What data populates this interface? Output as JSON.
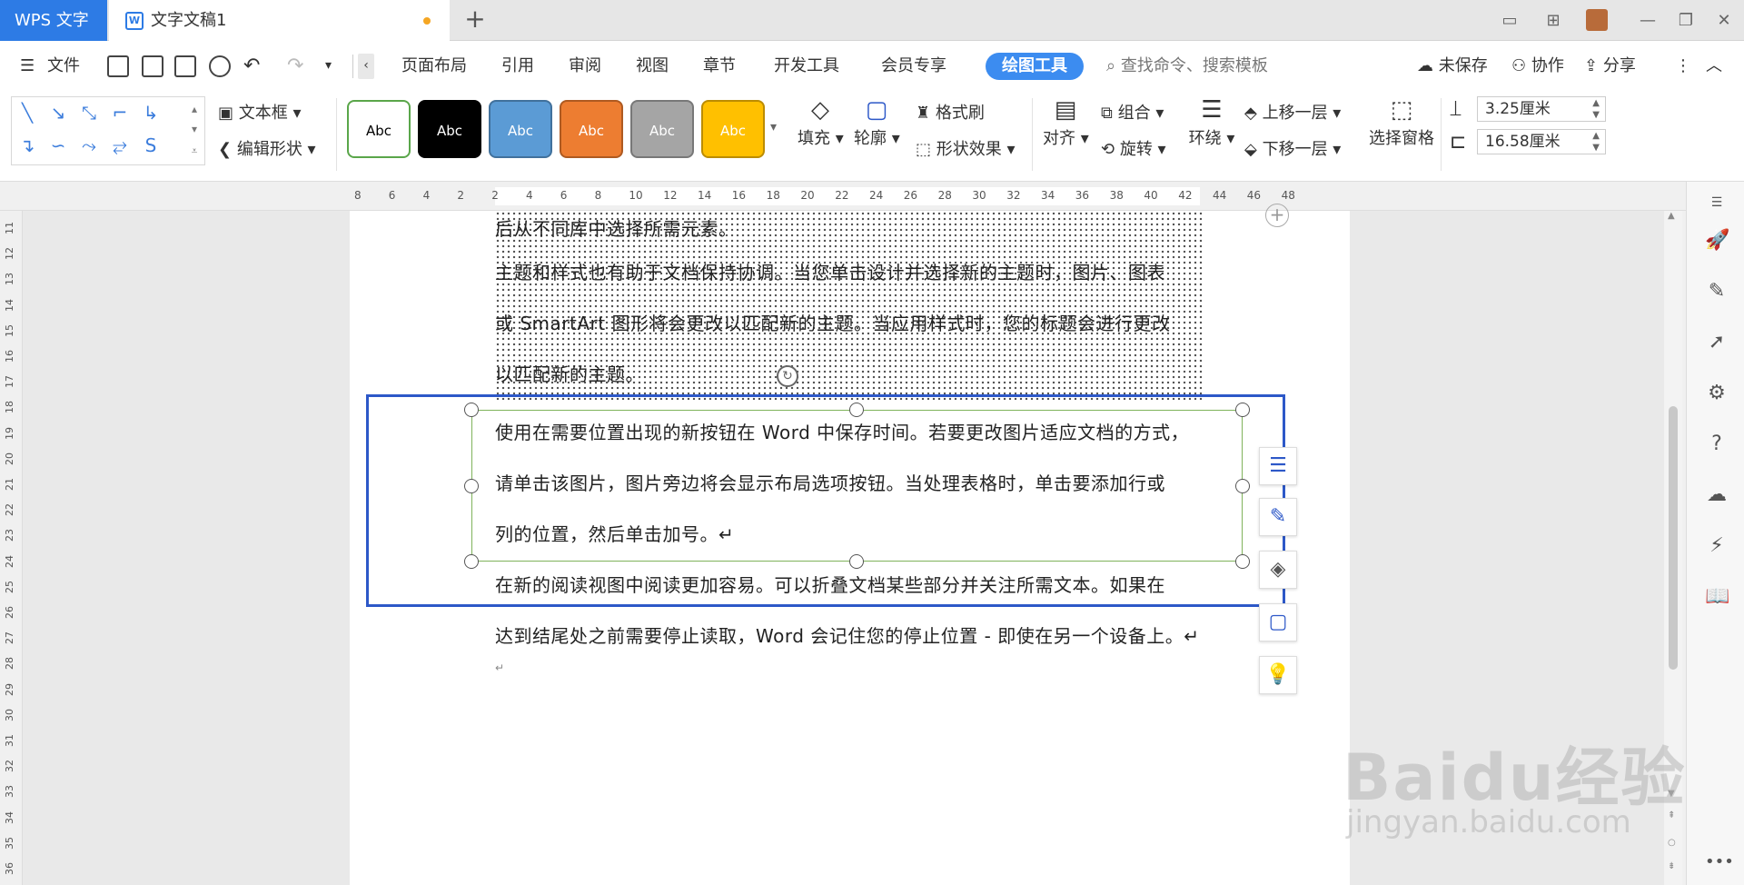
{
  "tabbar": {
    "app_tab": "WPS 文字",
    "doc_tab": "文字文稿1",
    "new_tab": "+"
  },
  "menubar": {
    "file": "文件",
    "items": [
      "页面布局",
      "引用",
      "审阅",
      "视图",
      "章节",
      "开发工具",
      "会员专享"
    ],
    "active": "绘图工具",
    "search_placeholder": "查找命令、搜索模板",
    "unsaved": "未保存",
    "collab": "协作",
    "share": "分享"
  },
  "ribbon": {
    "textbox": "文本框",
    "edit_shape": "编辑形状",
    "styles": [
      {
        "label": "Abc",
        "bg": "#ffffff",
        "fg": "#000000",
        "border": "#5aa64a"
      },
      {
        "label": "Abc",
        "bg": "#000000",
        "fg": "#ffffff",
        "border": "#000000"
      },
      {
        "label": "Abc",
        "bg": "#5b9bd5",
        "fg": "#ffffff",
        "border": "#41719c"
      },
      {
        "label": "Abc",
        "bg": "#ed7d31",
        "fg": "#ffffff",
        "border": "#ae5a21"
      },
      {
        "label": "Abc",
        "bg": "#a5a5a5",
        "fg": "#ffffff",
        "border": "#787878"
      },
      {
        "label": "Abc",
        "bg": "#ffc000",
        "fg": "#ffffff",
        "border": "#bc8c00"
      }
    ],
    "fill": "填充",
    "outline": "轮廓",
    "format_painter": "格式刷",
    "shape_effects": "形状效果",
    "align": "对齐",
    "group": "组合",
    "rotate": "旋转",
    "wrap": "环绕",
    "bring_forward": "上移一层",
    "send_backward": "下移一层",
    "selection_pane": "选择窗格",
    "height_value": "3.25厘米",
    "width_value": "16.58厘米"
  },
  "ruler": {
    "h_ticks": [
      "8",
      "6",
      "4",
      "2",
      "2",
      "4",
      "6",
      "8",
      "10",
      "12",
      "14",
      "16",
      "18",
      "20",
      "22",
      "24",
      "26",
      "28",
      "30",
      "32",
      "34",
      "36",
      "38",
      "40",
      "42",
      "44",
      "46",
      "48"
    ],
    "v_ticks": [
      "11",
      "12",
      "13",
      "14",
      "15",
      "16",
      "17",
      "18",
      "19",
      "20",
      "21",
      "22",
      "23",
      "24",
      "25",
      "26",
      "27",
      "28",
      "29",
      "30",
      "31",
      "32",
      "33",
      "34",
      "35",
      "36"
    ]
  },
  "document": {
    "shaded_lines": [
      "后从不同库中选择所需元素。",
      "主题和样式也有助于文档保持协调。当您单击设计并选择新的主题时，图片、图表",
      "或 SmartArt 图形将会更改以匹配新的主题。当应用样式时，您的标题会进行更改",
      "以匹配新的主题。"
    ],
    "textbox_lines": [
      "使用在需要位置出现的新按钮在 Word 中保存时间。若要更改图片适应文档的方式，",
      "请单击该图片，图片旁边将会显示布局选项按钮。当处理表格时，单击要添加行或",
      "列的位置，然后单击加号。↵"
    ],
    "body_lines": [
      "在新的阅读视图中阅读更加容易。可以折叠文档某些部分并关注所需文本。如果在",
      "达到结尾处之前需要停止读取，Word 会记住您的停止位置 - 即使在另一个设备上。↵",
      "↵"
    ]
  },
  "watermark": {
    "main": "Baidu经验",
    "sub": "jingyan.baidu.com"
  },
  "colors": {
    "accent": "#2d7be5",
    "selection_blue": "#2d58c8",
    "textbox_border": "#7fb35b"
  }
}
